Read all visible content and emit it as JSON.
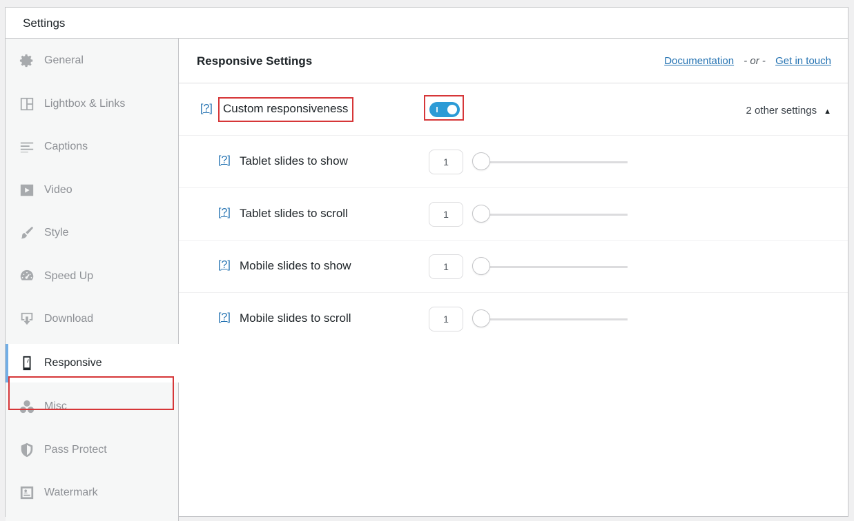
{
  "panel": {
    "title": "Settings"
  },
  "sidebar": {
    "items": [
      {
        "label": "General",
        "icon": "gear-icon"
      },
      {
        "label": "Lightbox & Links",
        "icon": "layout-icon"
      },
      {
        "label": "Captions",
        "icon": "text-lines-icon"
      },
      {
        "label": "Video",
        "icon": "video-play-icon"
      },
      {
        "label": "Style",
        "icon": "paintbrush-icon"
      },
      {
        "label": "Speed Up",
        "icon": "speedometer-icon"
      },
      {
        "label": "Download",
        "icon": "download-icon"
      },
      {
        "label": "Responsive",
        "icon": "smartphone-icon",
        "active": true
      },
      {
        "label": "Misc",
        "icon": "circles-icon"
      },
      {
        "label": "Pass Protect",
        "icon": "shield-icon"
      },
      {
        "label": "Watermark",
        "icon": "watermark-icon"
      }
    ]
  },
  "content": {
    "title": "Responsive Settings",
    "links": {
      "documentation": "Documentation",
      "separator": "- or -",
      "contact": "Get in touch"
    },
    "custom_row": {
      "help": "[?]",
      "label": "Custom responsiveness",
      "toggle_on": true,
      "other_settings": "2 other settings",
      "caret": "▲"
    },
    "rows": [
      {
        "help": "[?]",
        "label": "Tablet slides to show",
        "value": "1"
      },
      {
        "help": "[?]",
        "label": "Tablet slides to scroll",
        "value": "1"
      },
      {
        "help": "[?]",
        "label": "Mobile slides to show",
        "value": "1"
      },
      {
        "help": "[?]",
        "label": "Mobile slides to scroll",
        "value": "1"
      }
    ]
  },
  "colors": {
    "accent": "#2c9bd6",
    "link": "#2271b1",
    "highlight": "#d63638",
    "active_border": "#72aee6"
  }
}
